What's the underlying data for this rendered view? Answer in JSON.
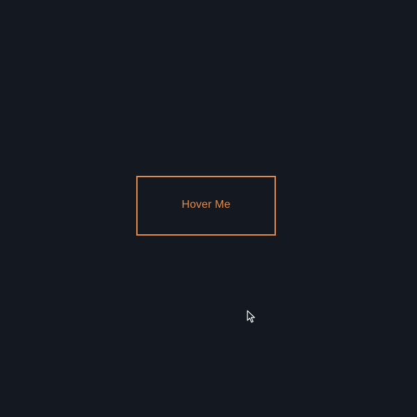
{
  "page": {
    "background_color": "#141821",
    "accent_color": "#e08a4b"
  },
  "button": {
    "label": "Hover Me"
  },
  "cursor": {
    "icon": "arrow-pointer-icon"
  }
}
